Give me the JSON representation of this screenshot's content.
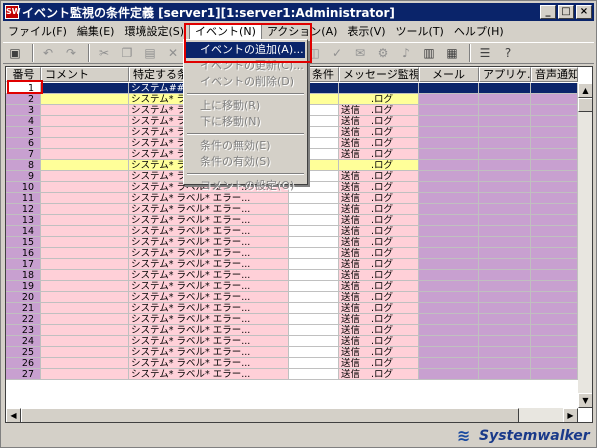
{
  "window": {
    "title": "イベント監視の条件定義 [server1][1:server1:Administrator]",
    "app_icon": "app-icon"
  },
  "menubar": {
    "items": [
      {
        "label": "ファイル(F)"
      },
      {
        "label": "編集(E)"
      },
      {
        "label": "環境設定(S)"
      },
      {
        "label": "イベント(N)"
      },
      {
        "label": "アクション(A)"
      },
      {
        "label": "表示(V)"
      },
      {
        "label": "ツール(T)"
      },
      {
        "label": "ヘルプ(H)"
      }
    ],
    "active_index": 3
  },
  "event_menu": {
    "items": [
      {
        "label": "イベントの追加(A)...",
        "state": "highlighted"
      },
      {
        "label": "イベントの更新(C)...",
        "state": "disabled"
      },
      {
        "label": "イベントの削除(D)",
        "state": "disabled"
      },
      {
        "type": "separator"
      },
      {
        "label": "上に移動(R)",
        "state": "disabled"
      },
      {
        "label": "下に移動(N)",
        "state": "disabled"
      },
      {
        "type": "separator"
      },
      {
        "label": "条件の無効(E)",
        "state": "disabled"
      },
      {
        "label": "条件の有効(S)",
        "state": "disabled"
      },
      {
        "type": "separator"
      },
      {
        "label": "コメントの設定(O)",
        "state": "disabled"
      }
    ]
  },
  "grid": {
    "columns": [
      "番号",
      "コメント",
      "特定する条件",
      "条件",
      "メッセージ監視",
      "メール",
      "アプリケ...",
      "音声通知"
    ],
    "rows": [
      {
        "num": "1",
        "cond": "システム###",
        "msg_a": "",
        "msg_b": "",
        "style": "selected"
      },
      {
        "num": "2",
        "cond": "システム* ラベ",
        "msg_a": "",
        "msg_b": ".ログ",
        "style": "yellow"
      },
      {
        "num": "3",
        "cond": "システム* ラベ",
        "msg_a": "送信",
        "msg_b": ".ログ",
        "style": ""
      },
      {
        "num": "4",
        "cond": "システム* ラベ",
        "msg_a": "送信",
        "msg_b": ".ログ",
        "style": ""
      },
      {
        "num": "5",
        "cond": "システム* ラベ",
        "msg_a": "送信",
        "msg_b": ".ログ",
        "style": ""
      },
      {
        "num": "6",
        "cond": "システム* ラベ",
        "msg_a": "送信",
        "msg_b": ".ログ",
        "style": ""
      },
      {
        "num": "7",
        "cond": "システム* ラベ",
        "msg_a": "送信",
        "msg_b": ".ログ",
        "style": ""
      },
      {
        "num": "8",
        "cond": "システム* ラベ",
        "msg_a": "",
        "msg_b": ".ログ",
        "style": "yellow"
      },
      {
        "num": "9",
        "cond": "システム* ラベル* エラー...",
        "msg_a": "送信",
        "msg_b": ".ログ",
        "style": ""
      },
      {
        "num": "10",
        "cond": "システム* ラベル* エラー...",
        "msg_a": "送信",
        "msg_b": ".ログ",
        "style": ""
      },
      {
        "num": "11",
        "cond": "システム* ラベル* エラー...",
        "msg_a": "送信",
        "msg_b": ".ログ",
        "style": ""
      },
      {
        "num": "12",
        "cond": "システム* ラベル* エラー...",
        "msg_a": "送信",
        "msg_b": ".ログ",
        "style": ""
      },
      {
        "num": "13",
        "cond": "システム* ラベル* エラー...",
        "msg_a": "送信",
        "msg_b": ".ログ",
        "style": ""
      },
      {
        "num": "14",
        "cond": "システム* ラベル* エラー...",
        "msg_a": "送信",
        "msg_b": ".ログ",
        "style": ""
      },
      {
        "num": "15",
        "cond": "システム* ラベル* エラー...",
        "msg_a": "送信",
        "msg_b": ".ログ",
        "style": ""
      },
      {
        "num": "16",
        "cond": "システム* ラベル* エラー...",
        "msg_a": "送信",
        "msg_b": ".ログ",
        "style": ""
      },
      {
        "num": "17",
        "cond": "システム* ラベル* エラー...",
        "msg_a": "送信",
        "msg_b": ".ログ",
        "style": ""
      },
      {
        "num": "18",
        "cond": "システム* ラベル* エラー...",
        "msg_a": "送信",
        "msg_b": ".ログ",
        "style": ""
      },
      {
        "num": "19",
        "cond": "システム* ラベル* エラー...",
        "msg_a": "送信",
        "msg_b": ".ログ",
        "style": ""
      },
      {
        "num": "20",
        "cond": "システム* ラベル* エラー...",
        "msg_a": "送信",
        "msg_b": ".ログ",
        "style": ""
      },
      {
        "num": "21",
        "cond": "システム* ラベル* エラー...",
        "msg_a": "送信",
        "msg_b": ".ログ",
        "style": ""
      },
      {
        "num": "22",
        "cond": "システム* ラベル* エラー...",
        "msg_a": "送信",
        "msg_b": ".ログ",
        "style": ""
      },
      {
        "num": "23",
        "cond": "システム* ラベル* エラー...",
        "msg_a": "送信",
        "msg_b": ".ログ",
        "style": ""
      },
      {
        "num": "24",
        "cond": "システム* ラベル* エラー...",
        "msg_a": "送信",
        "msg_b": ".ログ",
        "style": ""
      },
      {
        "num": "25",
        "cond": "システム* ラベル* エラー...",
        "msg_a": "送信",
        "msg_b": ".ログ",
        "style": ""
      },
      {
        "num": "26",
        "cond": "システム* ラベル* エラー...",
        "msg_a": "送信",
        "msg_b": ".ログ",
        "style": ""
      },
      {
        "num": "27",
        "cond": "システム* ラベル* エラー...",
        "msg_a": "送信",
        "msg_b": ".ログ",
        "style": ""
      }
    ]
  },
  "brand": {
    "name": "Systemwalker"
  },
  "colors": {
    "title_bar": "#0a246a",
    "highlight": "#0a246a",
    "row_pink": "#ffd0d8",
    "row_purple": "#c8a0d0",
    "row_yellow": "#ffff99",
    "annotation_red": "#e00000"
  }
}
